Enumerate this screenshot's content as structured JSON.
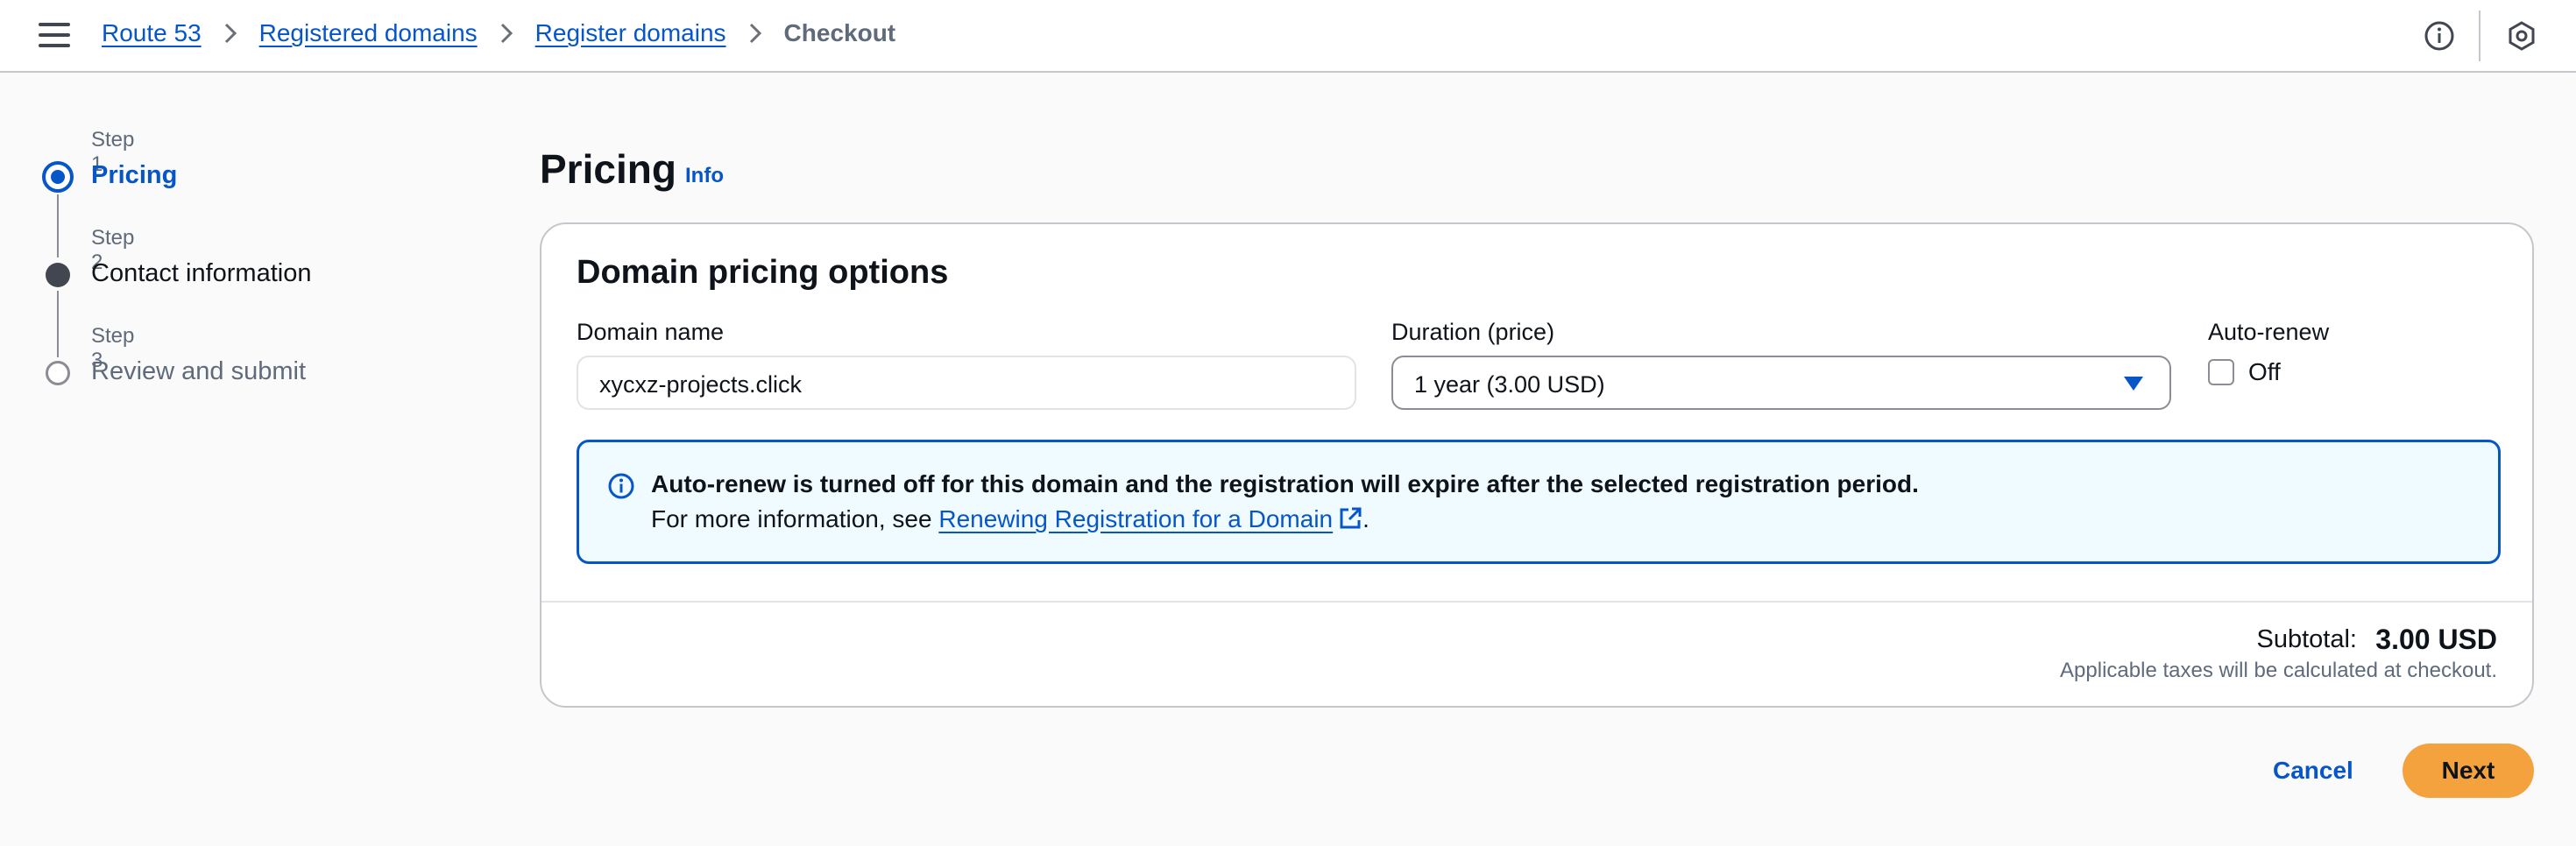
{
  "breadcrumb": {
    "items": [
      "Route 53",
      "Registered domains",
      "Register domains"
    ],
    "current": "Checkout"
  },
  "steps": [
    {
      "number": "Step 1",
      "title": "Pricing",
      "state": "active"
    },
    {
      "number": "Step 2",
      "title": "Contact information",
      "state": "completed"
    },
    {
      "number": "Step 3",
      "title": "Review and submit",
      "state": "pending"
    }
  ],
  "page": {
    "title": "Pricing",
    "info_link": "Info"
  },
  "card": {
    "header": "Domain pricing options",
    "domain_label": "Domain name",
    "domain_value": "xycxz-projects.click",
    "duration_label": "Duration (price)",
    "duration_value": "1 year (3.00 USD)",
    "autorenew_label": "Auto-renew",
    "autorenew_value": "Off",
    "alert": {
      "title": "Auto-renew is turned off for this domain and the registration will expire after the selected registration period.",
      "body_prefix": "For more information, see",
      "link": "Renewing Registration for a Domain",
      "body_suffix": "."
    },
    "subtotal_label": "Subtotal:",
    "subtotal_value": "3.00 USD",
    "tax_note": "Applicable taxes will be calculated at checkout."
  },
  "actions": {
    "cancel": "Cancel",
    "next": "Next"
  },
  "colors": {
    "accent": "#0656c8",
    "primary_button": "#f4a23d",
    "info_background": "#f0fbff"
  },
  "icons": [
    "menu-icon",
    "chevron-right-icon",
    "info-icon",
    "settings-hex-icon",
    "external-link-icon"
  ]
}
